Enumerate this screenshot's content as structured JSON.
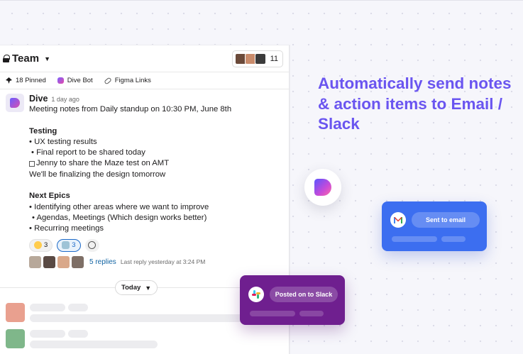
{
  "channel": {
    "name": "Team",
    "member_count": "11"
  },
  "bookmarks": [
    {
      "label": "18 Pinned",
      "icon": "pin-icon"
    },
    {
      "label": "Dive Bot",
      "icon": "dive-bot-icon"
    },
    {
      "label": "Figma Links",
      "icon": "link-icon"
    }
  ],
  "message": {
    "author": "Dive",
    "time": "1 day ago",
    "lines": [
      "Meeting notes from Daily standup on 10:30 PM, June 8th",
      "Testing",
      "• UX testing results",
      "• Final report to be shared today",
      "Jenny to share the Maze test on AMT",
      "We'll be finalizing the design tomorrow",
      "Next Epics",
      "• Identifying other areas where we want to improve",
      "• Agendas, Meetings (Which design works better)",
      "• Recurring meetings"
    ],
    "reactions": [
      {
        "emoji": "sunglasses-emoji-icon",
        "count": "3",
        "active": false
      },
      {
        "emoji": "robot-emoji-icon",
        "count": "3",
        "active": true
      }
    ],
    "thread": {
      "replies": "5 replies",
      "last_reply": "Last reply yesterday at 3:24 PM"
    }
  },
  "date_divider": "Today",
  "headline": "Automatically send notes & action items to Email / Slack",
  "email_card": {
    "label": "Sent to email",
    "color": "#3c6ef0"
  },
  "slack_card": {
    "label": "Posted on to Slack",
    "color": "#6f1f8f"
  },
  "colors": {
    "accent": "#6a55f0",
    "link": "#1264a3"
  }
}
